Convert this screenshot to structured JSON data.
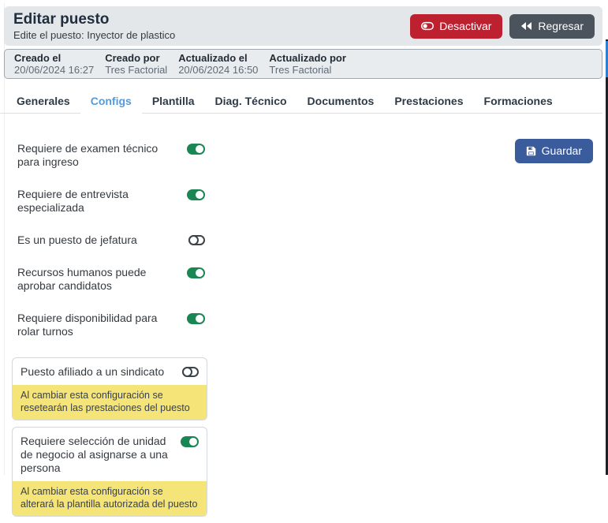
{
  "header": {
    "title": "Editar puesto",
    "subtitle": "Edite el puesto: Inyector de plastico",
    "deactivate_label": "Desactivar",
    "back_label": "Regresar"
  },
  "meta": {
    "items": [
      {
        "label": "Creado el",
        "value": "20/06/2024 16:27"
      },
      {
        "label": "Creado por",
        "value": "Tres Factorial"
      },
      {
        "label": "Actualizado el",
        "value": "20/06/2024 16:50"
      },
      {
        "label": "Actualizado por",
        "value": "Tres Factorial"
      }
    ]
  },
  "tabs": {
    "active_index": 1,
    "items": [
      "Generales",
      "Configs",
      "Plantilla",
      "Diag. Técnico",
      "Documentos",
      "Prestaciones",
      "Formaciones"
    ]
  },
  "settings": {
    "save_label": "Guardar",
    "toggles": [
      {
        "label": "Requiere de examen técnico para ingreso",
        "state": "on"
      },
      {
        "label": "Requiere de entrevista especializada",
        "state": "on"
      },
      {
        "label": "Es un puesto de jefatura",
        "state": "off"
      },
      {
        "label": "Recursos humanos puede aprobar candidatos",
        "state": "on"
      },
      {
        "label": "Requiere disponibilidad para rolar turnos",
        "state": "on"
      },
      {
        "label": "Puesto afiliado a un sindicato",
        "state": "off",
        "warning": "Al cambiar esta configuración se resetearán las prestaciones del puesto"
      },
      {
        "label": "Requiere selección de unidad de negocio al asignarse a una persona",
        "state": "on",
        "warning": "Al cambiar esta configuración se alterará la plantilla autorizada del puesto"
      }
    ]
  },
  "colors": {
    "header_bg": "#e3e7ea",
    "meta_bg": "#e9ecef",
    "danger": "#bd2130",
    "slate": "#4b545c",
    "primary": "#3a5b9c",
    "toggle_on": "#198754",
    "toggle_off": "#3d444b",
    "active_tab": "#569ad8",
    "warning_bg": "#f5e478",
    "scroll_thumb": "#2e7ed2"
  }
}
